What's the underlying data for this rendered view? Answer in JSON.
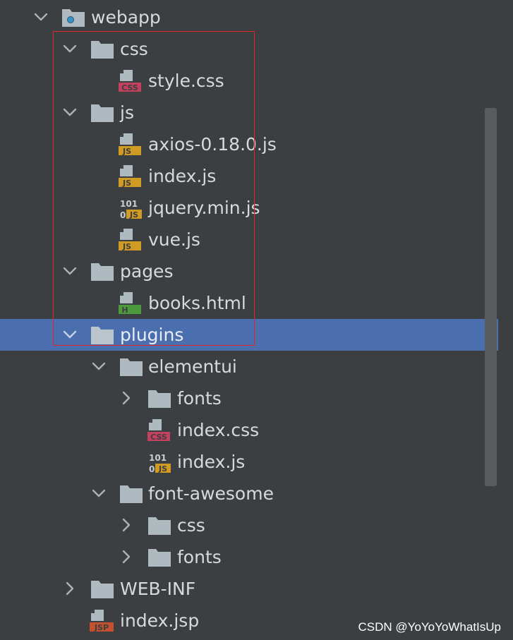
{
  "tree": {
    "root_label": "webapp",
    "css_folder": "css",
    "style_css": "style.css",
    "js_folder": "js",
    "axios_js": "axios-0.18.0.js",
    "index_js": "index.js",
    "jquery_js": "jquery.min.js",
    "vue_js": "vue.js",
    "pages_folder": "pages",
    "books_html": "books.html",
    "plugins_folder": "plugins",
    "elementui_folder": "elementui",
    "elementui_fonts_folder": "fonts",
    "elementui_index_css": "index.css",
    "elementui_index_js": "index.js",
    "fontawesome_folder": "font-awesome",
    "fontawesome_css_folder": "css",
    "fontawesome_fonts_folder": "fonts",
    "webinf_folder": "WEB-INF",
    "index_jsp": "index.jsp"
  },
  "badges": {
    "css": "CSS",
    "js": "JS",
    "html": "H",
    "jsp": "JSP",
    "bin_top": "101",
    "bin_left": "0",
    "bin_js": "JS"
  },
  "icons": {
    "folder": "folder-icon",
    "web_module": "web-module-folder-icon",
    "css_file": "css-file-icon",
    "js_file": "js-file-icon",
    "minified_js_file": "minified-js-file-icon",
    "html_file": "html-file-icon",
    "jsp_file": "jsp-file-icon"
  },
  "colors": {
    "background": "#3c3f41",
    "selection": "#4b6eaf",
    "text": "#d7dadc",
    "folder": "#aeb9c0",
    "css_badge": "#c4405f",
    "js_badge": "#d19a22",
    "html_badge": "#4c9a3d",
    "jsp_badge": "#c4502c",
    "highlight_border": "#e0262b",
    "scrollbar": "#595b5d"
  },
  "watermark": "CSDN @YoYoYoWhatIsUp"
}
